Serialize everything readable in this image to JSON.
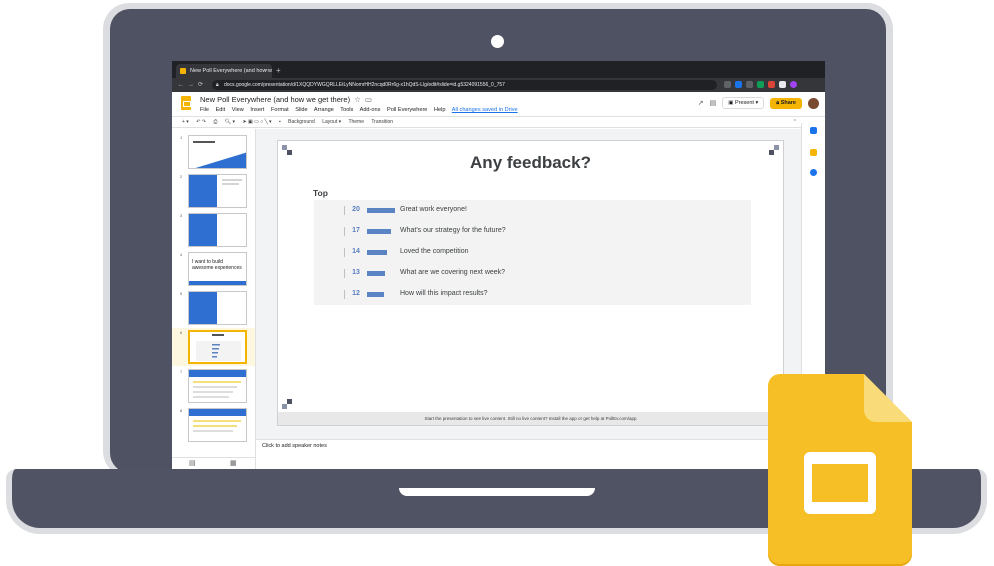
{
  "browser": {
    "tab_title": "New Poll Everywhere (and how w",
    "tab_close": "×",
    "new_tab": "+",
    "url": "docs.google.com/presentation/d/1XQQDYWGQRLLEtLyNNomrHH2ncqd0Rr6g-x1hQdS-Llg/edit#slide=id.g5324091556_0_757"
  },
  "app": {
    "doc_title": "New Poll Everywhere (and how we get there)",
    "star_icon": "star-icon",
    "menus": [
      "File",
      "Edit",
      "View",
      "Insert",
      "Format",
      "Slide",
      "Arrange",
      "Tools",
      "Add-ons",
      "Poll Everywhere",
      "Help"
    ],
    "saved_status": "All changes saved in Drive",
    "present_label": "Present",
    "share_label": "Share",
    "toolbar": [
      "Background",
      "Layout ▾",
      "Theme",
      "Transition"
    ]
  },
  "filmstrip": {
    "slide_numbers": [
      "1",
      "2",
      "3",
      "4",
      "5",
      "6",
      "7",
      "8"
    ],
    "slide4_text": "I want to build awesome experiences"
  },
  "slide": {
    "title": "Any feedback?",
    "section_label": "Top",
    "responses": [
      {
        "count": "20",
        "text": "Great work everyone!",
        "votes": 20
      },
      {
        "count": "17",
        "text": "What's our strategy for the future?",
        "votes": 17
      },
      {
        "count": "14",
        "text": "Loved the competition",
        "votes": 14
      },
      {
        "count": "13",
        "text": "What are we covering next week?",
        "votes": 13
      },
      {
        "count": "12",
        "text": "How will this impact results?",
        "votes": 12
      }
    ],
    "footer": "Start the presentation to see live content. Still no live content? Install the app or get help at PollEv.com/app"
  },
  "notes": {
    "placeholder": "Click to add speaker notes"
  },
  "colors": {
    "accent": "#f4b400",
    "bar": "#5b84c4",
    "laptop": "#4e5262"
  }
}
